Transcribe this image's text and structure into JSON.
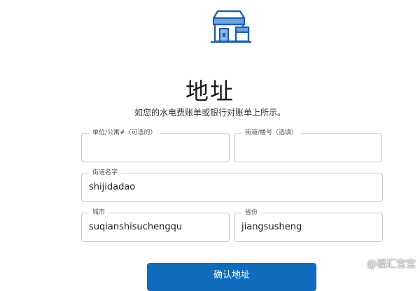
{
  "header": {
    "logo_icon": "store-building-icon",
    "title": "地址",
    "subtitle": "如您的水电费账单或银行对账单上所示。"
  },
  "form": {
    "unit": {
      "label": "单位/公寓#（可选的）",
      "value": ""
    },
    "street_no": {
      "label": "街道/楼号（选填）",
      "value": ""
    },
    "street_name": {
      "label": "街道名字",
      "value": "shijidadao"
    },
    "city": {
      "label": "城市",
      "value": "suqianshisuchengqu"
    },
    "province": {
      "label": "省份",
      "value": "jiangsusheng"
    }
  },
  "actions": {
    "confirm_label": "确认地址"
  },
  "watermark": {
    "text": "@福汇宝宝"
  },
  "colors": {
    "accent": "#0f6cbd",
    "border": "#c8c8c8"
  }
}
